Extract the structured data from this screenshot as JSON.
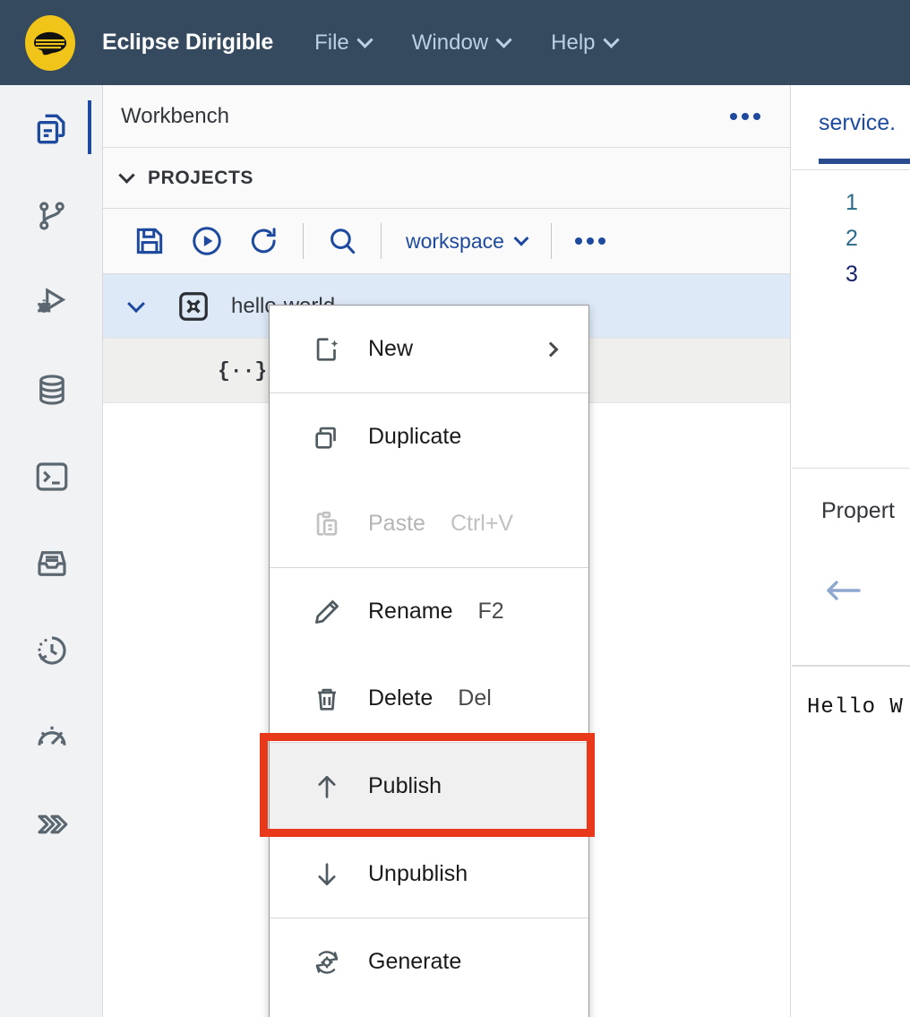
{
  "header": {
    "logo_icon": "dirigible-logo-icon",
    "brand": "Eclipse Dirigible",
    "menus": [
      {
        "label": "File",
        "icon": "chevron-down-icon"
      },
      {
        "label": "Window",
        "icon": "chevron-down-icon"
      },
      {
        "label": "Help",
        "icon": "chevron-down-icon"
      }
    ],
    "background_color": "#354a5f",
    "logo_color": "#f0c419",
    "text_color": "#ffffff",
    "menu_text_color": "#bcd0e4"
  },
  "rail": {
    "items": [
      {
        "icon": "files-copy-icon",
        "active": true
      },
      {
        "icon": "git-branch-icon",
        "active": false
      },
      {
        "icon": "debug-bug-icon",
        "active": false
      },
      {
        "icon": "database-icon",
        "active": false
      },
      {
        "icon": "terminal-icon",
        "active": false
      },
      {
        "icon": "inbox-archive-icon",
        "active": false
      },
      {
        "icon": "history-clock-icon",
        "active": false
      },
      {
        "icon": "gauge-icon",
        "active": false
      },
      {
        "icon": "double-chevron-icon",
        "active": false
      }
    ],
    "active_indicator_color": "#1d4a9e"
  },
  "workbench": {
    "title": "Workbench",
    "more_icon": "ellipsis-icon",
    "section": {
      "label": "PROJECTS",
      "expand_icon": "chevron-down-icon",
      "expanded": true
    },
    "toolbar": {
      "buttons": [
        {
          "icon": "save-icon",
          "name": "save-button"
        },
        {
          "icon": "run-play-icon",
          "name": "run-button"
        },
        {
          "icon": "refresh-icon",
          "name": "refresh-button"
        },
        {
          "icon": "search-icon",
          "name": "search-button"
        }
      ],
      "workspace_label": "workspace",
      "workspace_chevron": "chevron-down-icon",
      "more_icon": "ellipsis-icon",
      "accent_color": "#1d4a9e"
    },
    "tree": [
      {
        "label": "hello-world",
        "icon": "project-icon",
        "expand_icon": "chevron-down-icon",
        "expanded": true,
        "selected": true
      },
      {
        "label": "",
        "icon": "json-file-icon",
        "icon_glyph": "{··}",
        "selected": false
      }
    ],
    "selected_row_color": "#dde9f7"
  },
  "context_menu": {
    "groups": [
      {
        "items": [
          {
            "label": "New",
            "icon": "new-file-icon",
            "shortcut": "",
            "submenu": true,
            "disabled": false,
            "highlighted": false
          }
        ]
      },
      {
        "items": [
          {
            "label": "Duplicate",
            "icon": "duplicate-icon",
            "shortcut": "",
            "submenu": false,
            "disabled": false,
            "highlighted": false
          },
          {
            "label": "Paste",
            "icon": "paste-icon",
            "shortcut": "Ctrl+V",
            "submenu": false,
            "disabled": true,
            "highlighted": false
          }
        ]
      },
      {
        "items": [
          {
            "label": "Rename",
            "icon": "pencil-icon",
            "shortcut": "F2",
            "submenu": false,
            "disabled": false,
            "highlighted": false
          },
          {
            "label": "Delete",
            "icon": "trash-icon",
            "shortcut": "Del",
            "submenu": false,
            "disabled": false,
            "highlighted": false
          }
        ]
      },
      {
        "items": [
          {
            "label": "Publish",
            "icon": "arrow-up-icon",
            "shortcut": "",
            "submenu": false,
            "disabled": false,
            "highlighted": true
          }
        ]
      },
      {
        "items": [
          {
            "label": "Unpublish",
            "icon": "arrow-down-icon",
            "shortcut": "",
            "submenu": false,
            "disabled": false,
            "highlighted": false
          }
        ]
      },
      {
        "items": [
          {
            "label": "Generate",
            "icon": "generate-gear-icon",
            "shortcut": "",
            "submenu": false,
            "disabled": false,
            "highlighted": false
          }
        ]
      }
    ]
  },
  "annotation": {
    "target": "Publish",
    "color": "#e8391a"
  },
  "editor": {
    "tab_label": "service.",
    "active_tab_color": "#2a4b8d",
    "line_numbers": [
      "1",
      "2",
      "3"
    ]
  },
  "properties": {
    "title": "Propert",
    "back_icon": "arrow-left-icon"
  },
  "console": {
    "output": "Hello W"
  }
}
